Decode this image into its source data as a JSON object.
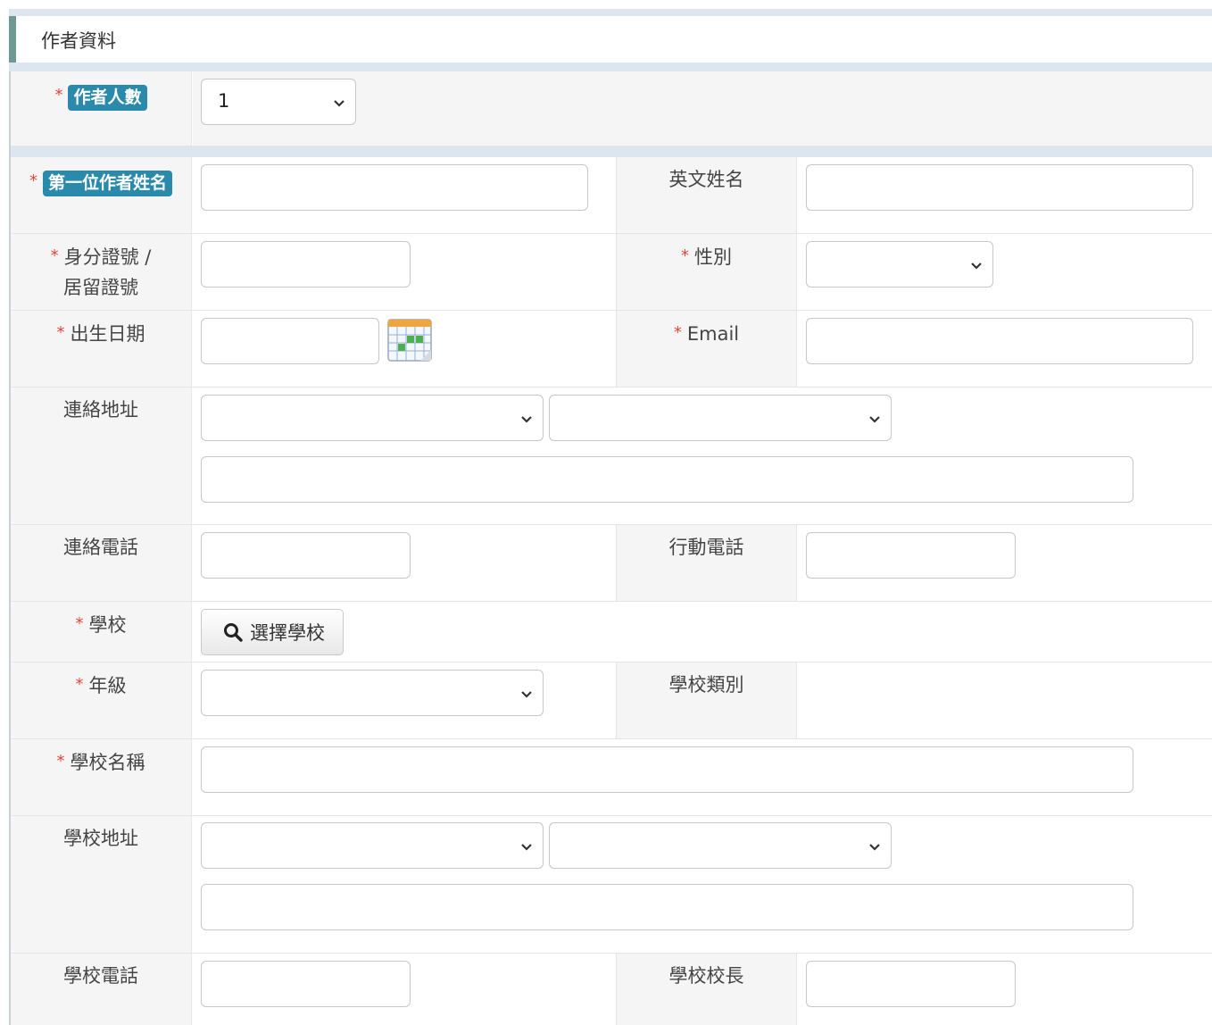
{
  "section": {
    "title": "作者資料"
  },
  "author_count": {
    "label": "作者人數",
    "value": "1"
  },
  "first_author_name": {
    "label": "第一位作者姓名",
    "value": ""
  },
  "english_name": {
    "label": "英文姓名",
    "value": ""
  },
  "id_number": {
    "label_line1": "身分證號 /",
    "label_line2": "居留證號",
    "value": ""
  },
  "gender": {
    "label": "性別",
    "value": ""
  },
  "birth_date": {
    "label": "出生日期",
    "value": ""
  },
  "email": {
    "label": "Email",
    "value": ""
  },
  "contact_address": {
    "label": "連絡地址",
    "city": "",
    "district": "",
    "street": ""
  },
  "contact_phone": {
    "label": "連絡電話",
    "value": ""
  },
  "mobile_phone": {
    "label": "行動電話",
    "value": ""
  },
  "school": {
    "label": "學校",
    "button_label": "選擇學校"
  },
  "grade": {
    "label": "年級",
    "value": ""
  },
  "school_type": {
    "label": "學校類別",
    "value": ""
  },
  "school_name": {
    "label": "學校名稱",
    "value": ""
  },
  "school_address": {
    "label": "學校地址",
    "city": "",
    "district": "",
    "street": ""
  },
  "school_phone": {
    "label": "學校電話",
    "value": ""
  },
  "school_principal": {
    "label": "學校校長",
    "value": ""
  },
  "required_mark": "*",
  "colors": {
    "badge": "#2a8aab",
    "required": "#e2453c",
    "accent_bar": "#6f9a94"
  },
  "icons": {
    "chevron": "chevron-down-icon",
    "search": "search-icon",
    "calendar": "calendar-icon"
  }
}
